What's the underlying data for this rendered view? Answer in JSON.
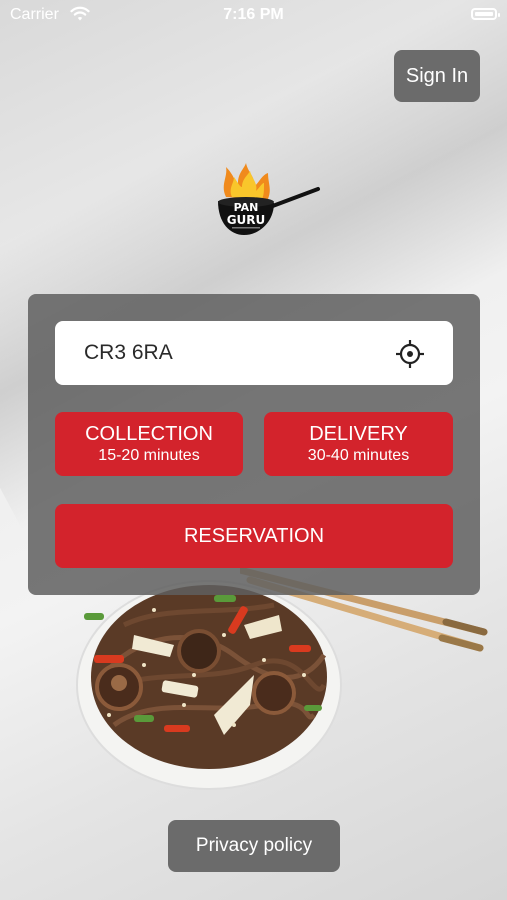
{
  "status_bar": {
    "carrier": "Carrier",
    "time": "7:16 PM"
  },
  "header": {
    "sign_in_label": "Sign In"
  },
  "logo": {
    "text_top": "PAN",
    "text_bottom": "GURU"
  },
  "order_panel": {
    "postcode_value": "CR3 6RA",
    "collection": {
      "label": "COLLECTION",
      "time": "15-20 minutes"
    },
    "delivery": {
      "label": "DELIVERY",
      "time": "30-40 minutes"
    },
    "reservation_label": "RESERVATION"
  },
  "footer": {
    "privacy_label": "Privacy policy"
  },
  "colors": {
    "accent": "#d3232c",
    "panel": "#5f5f5f",
    "button_grey": "#6b6b6b"
  },
  "icons": {
    "wifi": "wifi-icon",
    "battery": "battery-icon",
    "locate": "crosshair-location-icon"
  }
}
